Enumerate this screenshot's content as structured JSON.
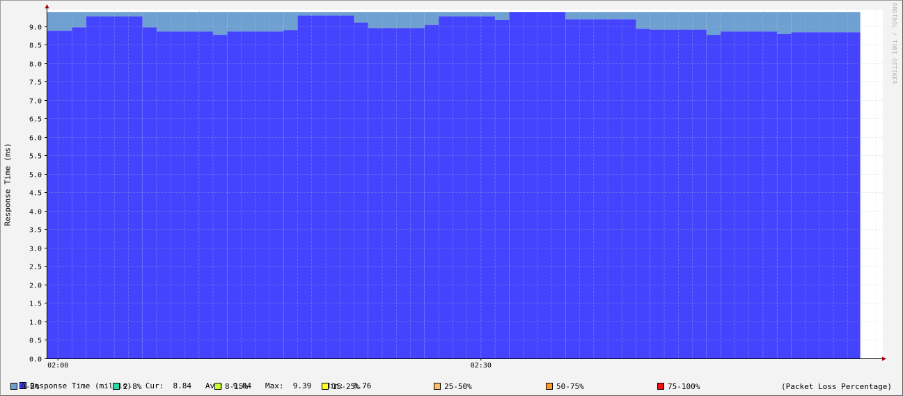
{
  "chart_data": {
    "type": "area",
    "ylabel": "Response Time (ms)",
    "watermark": "RRDTOOL / TOBI OETIKER",
    "ylim": [
      0,
      9.45
    ],
    "y_ticks": [
      "0.0",
      "0.5",
      "1.0",
      "1.5",
      "2.0",
      "2.5",
      "3.0",
      "3.5",
      "4.0",
      "4.5",
      "5.0",
      "5.5",
      "6.0",
      "6.5",
      "7.0",
      "7.5",
      "8.0",
      "8.5",
      "9.0"
    ],
    "x_tick_labels": [
      {
        "label": "02:00",
        "minute": 0
      },
      {
        "label": "02:30",
        "minute": 30
      }
    ],
    "x_range_minutes": [
      -0.8,
      58.5
    ],
    "data_end_minute": 56.9,
    "max_band_value": 9.39,
    "grid": true,
    "series": [
      {
        "name": "Response Time (millis)",
        "color": "#4444ff",
        "segments": [
          {
            "start": -0.8,
            "end": 1.0,
            "value": 8.88
          },
          {
            "start": 1.0,
            "end": 2.0,
            "value": 8.97
          },
          {
            "start": 2.0,
            "end": 6.0,
            "value": 9.27
          },
          {
            "start": 6.0,
            "end": 7.0,
            "value": 8.97
          },
          {
            "start": 7.0,
            "end": 11.0,
            "value": 8.86
          },
          {
            "start": 11.0,
            "end": 12.0,
            "value": 8.77
          },
          {
            "start": 12.0,
            "end": 16.0,
            "value": 8.86
          },
          {
            "start": 16.0,
            "end": 17.0,
            "value": 8.9
          },
          {
            "start": 17.0,
            "end": 21.0,
            "value": 9.29
          },
          {
            "start": 21.0,
            "end": 22.0,
            "value": 9.1
          },
          {
            "start": 22.0,
            "end": 26.0,
            "value": 8.95
          },
          {
            "start": 26.0,
            "end": 27.0,
            "value": 9.04
          },
          {
            "start": 27.0,
            "end": 31.0,
            "value": 9.27
          },
          {
            "start": 31.0,
            "end": 32.0,
            "value": 9.17
          },
          {
            "start": 32.0,
            "end": 36.0,
            "value": 9.39
          },
          {
            "start": 36.0,
            "end": 41.0,
            "value": 9.19
          },
          {
            "start": 41.0,
            "end": 42.0,
            "value": 8.93
          },
          {
            "start": 42.0,
            "end": 46.0,
            "value": 8.91
          },
          {
            "start": 46.0,
            "end": 47.0,
            "value": 8.77
          },
          {
            "start": 47.0,
            "end": 51.0,
            "value": 8.86
          },
          {
            "start": 51.0,
            "end": 52.0,
            "value": 8.79
          },
          {
            "start": 52.0,
            "end": 56.9,
            "value": 8.84
          }
        ]
      },
      {
        "name": "0-2%",
        "color": "#6ea0d2",
        "note": "packet loss band filled from response time up to max"
      }
    ]
  },
  "legend": {
    "stats_line": "Response Time (millis)   Cur:  8.84   Avg:  9.04   Max:  9.39   Min:  8.76",
    "response_color": "#4444ff",
    "loss_items": [
      {
        "label": "0-2%",
        "color": "#6ea0d2"
      },
      {
        "label": "2-8%",
        "color": "#2bd8a8"
      },
      {
        "label": "8-15%",
        "color": "#c6ff2c"
      },
      {
        "label": "15-25%",
        "color": "#ffff22"
      },
      {
        "label": "25-50%",
        "color": "#ffbb66"
      },
      {
        "label": "50-75%",
        "color": "#ff9922"
      },
      {
        "label": "75-100%",
        "color": "#ee1111"
      }
    ],
    "note": "(Packet Loss Percentage)"
  }
}
